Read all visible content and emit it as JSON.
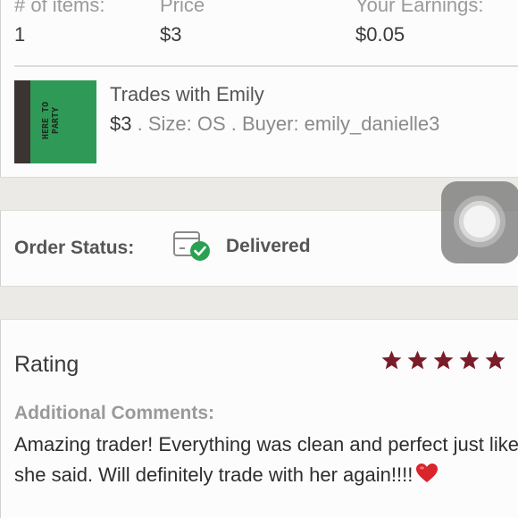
{
  "summary": {
    "items_header": "# of items:",
    "items_value": "1",
    "price_header": "Price",
    "price_value": "$3",
    "earnings_header": "Your Earnings:",
    "earnings_value": "$0.05"
  },
  "product": {
    "title": "Trades with Emily",
    "price": "$3",
    "separator1": " . ",
    "size": "Size: OS",
    "separator2": " . ",
    "buyer": "Buyer: emily_danielle3",
    "thumbnail_print": "HERE TO PARTY"
  },
  "order": {
    "status_label": "Order Status:",
    "status_value": "Delivered",
    "status_icon": "package-delivered-icon",
    "accent_color": "#2aa152"
  },
  "rating": {
    "label": "Rating",
    "stars": 5,
    "max_stars": 5,
    "star_color": "#7a1c2a"
  },
  "comments": {
    "label": "Additional Comments:",
    "text": "Amazing trader! Everything was clean and perfect just like she said. Will definitely trade with her again!!!!",
    "emoji": "heart-icon"
  }
}
